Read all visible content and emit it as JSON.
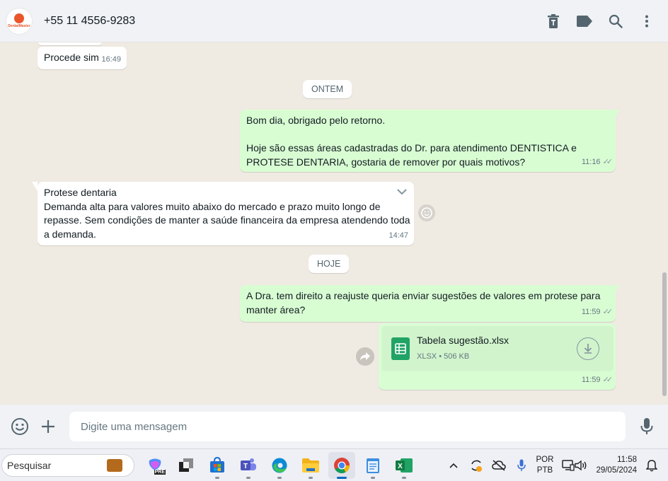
{
  "header": {
    "avatar_text": "DentalMaster",
    "contact_name": "+55 11 4556-9283",
    "icons": [
      "delete-icon",
      "label-icon",
      "search-icon",
      "more-vert-icon"
    ]
  },
  "chat": {
    "messages": [
      {
        "text": "Procede sim",
        "time": "16:49"
      },
      {
        "date_chip": "ONTEM"
      },
      {
        "line1": "Bom dia, obrigado pelo retorno.",
        "line2": "Hoje são essas áreas cadastradas do Dr. para atendimento DENTISTICA e PROTESE DENTARIA, gostaria de remover por quais motivos?",
        "time": "11:16"
      },
      {
        "title": "Protese dentaria",
        "text": "Demanda alta para valores muito abaixo do mercado e prazo muito longo de repasse. Sem condições de manter a saúde financeira da empresa atendendo toda a demanda.",
        "time": "14:47"
      },
      {
        "date_chip": "HOJE"
      },
      {
        "text": "A Dra. tem direito a reajuste queria enviar sugestões de valores em protese para manter área?",
        "time": "11:59"
      },
      {
        "file_name": "Tabela sugestão.xlsx",
        "file_type": "XLSX",
        "file_size": "506 KB",
        "time": "11:59"
      }
    ]
  },
  "compose": {
    "placeholder": "Digite uma mensagem"
  },
  "taskbar": {
    "search_label": "Pesquisar",
    "lang_line1": "POR",
    "lang_line2": "PTB",
    "time": "11:58",
    "date": "29/05/2024",
    "copilot_badge": "PRE"
  },
  "colors": {
    "incoming": "#ffffff",
    "outgoing": "#d9fdd3",
    "background": "#efeae2",
    "header": "#f0f2f5",
    "excel_green": "#21a366"
  }
}
